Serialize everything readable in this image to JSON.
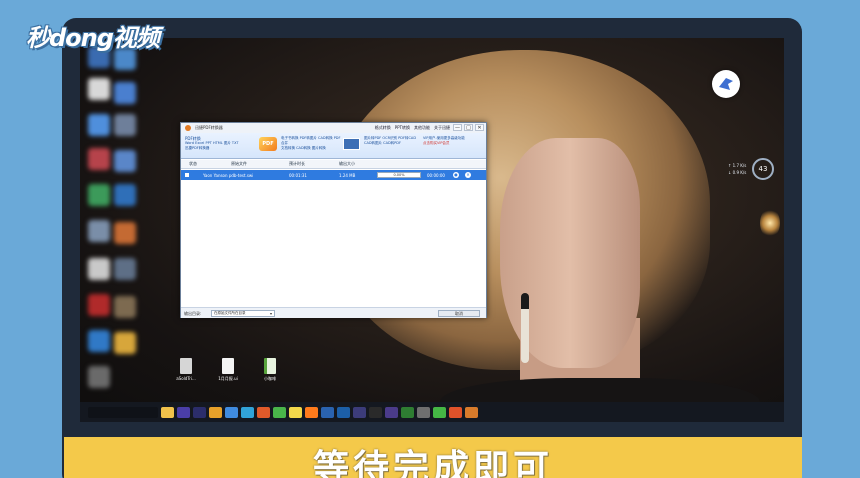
{
  "watermark": {
    "brand": "秒dong视频"
  },
  "subtitle": "等待完成即可",
  "app": {
    "title": "迅捷PDF转换器",
    "title_links": [
      "格式转换",
      "PPT转换",
      "其他功能",
      "关于迅捷"
    ],
    "window_controls": [
      "—",
      "□",
      "✕"
    ],
    "toolbar": {
      "group1_title": "PDF转换",
      "group1_items": "Word Excel PPT HTML 图片 TXT",
      "group1_extra": "迅捷PDF转换器",
      "pdf_badge": "PDF",
      "group2_items": "电子书转换  PDF转图片  CAD转换  PDF合并",
      "group2_extra": "文档转换  CAD转换  图片转换",
      "group3_items": "图片转PDF  OCR识别  PDF转CAD",
      "group3_extra": "CAD转图片  CAD转PDF",
      "promo": "VIP用户-使用更多高级功能",
      "promo_red": "点击购买VIP会员"
    },
    "columns": [
      "状态",
      "原始文件",
      "预计时长",
      "输出大小"
    ],
    "row": {
      "name": "Yaon Yanson   pdb-test.swi",
      "time": "00:01:31",
      "size": "1.24 MB",
      "progress_text": "0.00%",
      "progress": 0.0,
      "eta": "00:00:00"
    },
    "status_label": "输出目录:",
    "output_dir": "在原始文件所在目录",
    "cancel_label": "取消"
  },
  "desktop_files": [
    {
      "name": "aSoldTri..."
    },
    {
      "name": "1月月报.ui"
    },
    {
      "name": "小咖啡"
    }
  ],
  "net_widget": {
    "up": "↑ 1.7 K/s",
    "down": "↓ 0.9 K/s",
    "percent": "43"
  }
}
